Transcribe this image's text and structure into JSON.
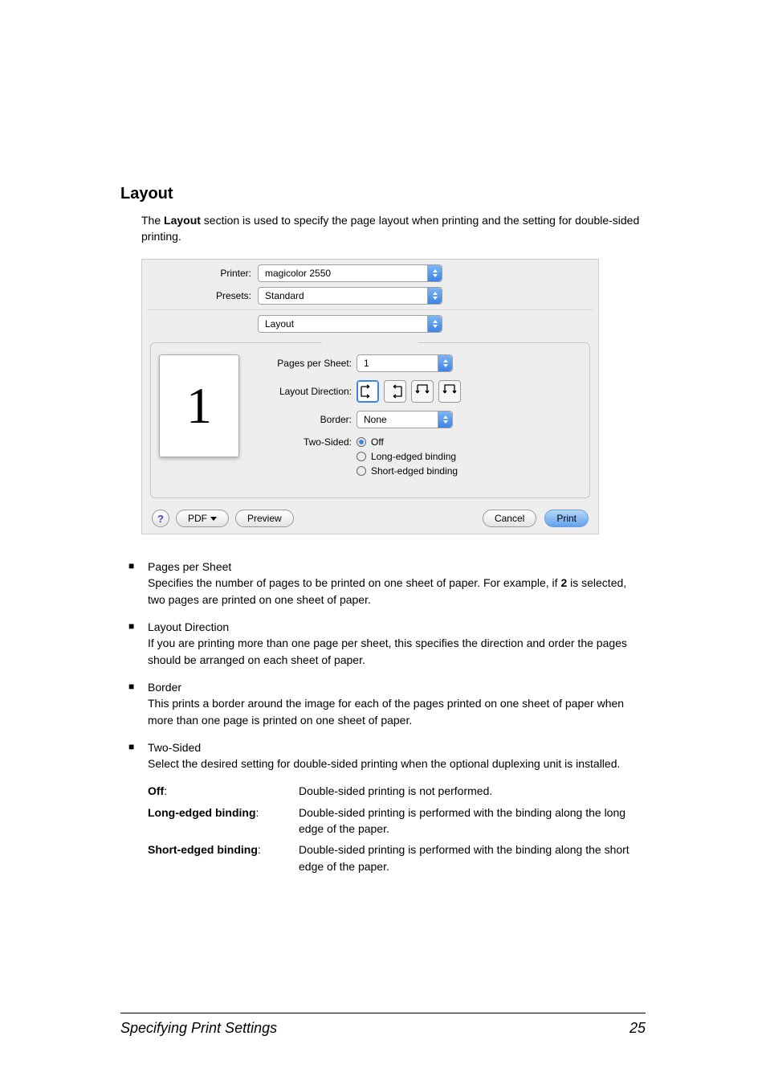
{
  "heading": "Layout",
  "intro_pre": "The ",
  "intro_bold": "Layout",
  "intro_post": " section is used to specify the page layout when printing and the setting for double-sided printing.",
  "dialog": {
    "printer_label": "Printer:",
    "printer_value": "magicolor 2550",
    "presets_label": "Presets:",
    "presets_value": "Standard",
    "section_value": "Layout",
    "pps_label": "Pages per Sheet:",
    "pps_value": "1",
    "dir_label": "Layout Direction:",
    "border_label": "Border:",
    "border_value": "None",
    "twosided_label": "Two-Sided:",
    "twosided_options": {
      "off": "Off",
      "long": "Long-edged binding",
      "short": "Short-edged binding"
    },
    "preview_number": "1",
    "help": "?",
    "pdf_btn": "PDF",
    "preview_btn": "Preview",
    "cancel_btn": "Cancel",
    "print_btn": "Print"
  },
  "bullets": [
    {
      "title": "Pages per Sheet",
      "body_pre": "Specifies the number of pages to be printed on one sheet of paper. For example, if ",
      "body_bold": "2",
      "body_post": " is selected, two pages are printed on one sheet of paper."
    },
    {
      "title": "Layout Direction",
      "body": "If you are printing more than one page per sheet, this specifies the direction and order the pages should be arranged on each sheet of paper."
    },
    {
      "title": "Border",
      "body": "This prints a border around the image for each of the pages printed on one sheet of paper when more than one page is printed on one sheet of paper."
    },
    {
      "title": "Two-Sided",
      "body": "Select the desired setting for double-sided printing when the optional duplexing unit is installed."
    }
  ],
  "options": [
    {
      "key": "Off",
      "suffix": ":",
      "val": "Double-sided printing is not performed."
    },
    {
      "key": "Long-edged binding",
      "suffix": ":",
      "val": "Double-sided printing is performed with the binding along the long edge of the paper."
    },
    {
      "key": "Short-edged binding",
      "suffix": ":",
      "val": "Double-sided printing is performed with the binding along the short edge of the paper."
    }
  ],
  "footer": {
    "title": "Specifying Print Settings",
    "page": "25"
  }
}
